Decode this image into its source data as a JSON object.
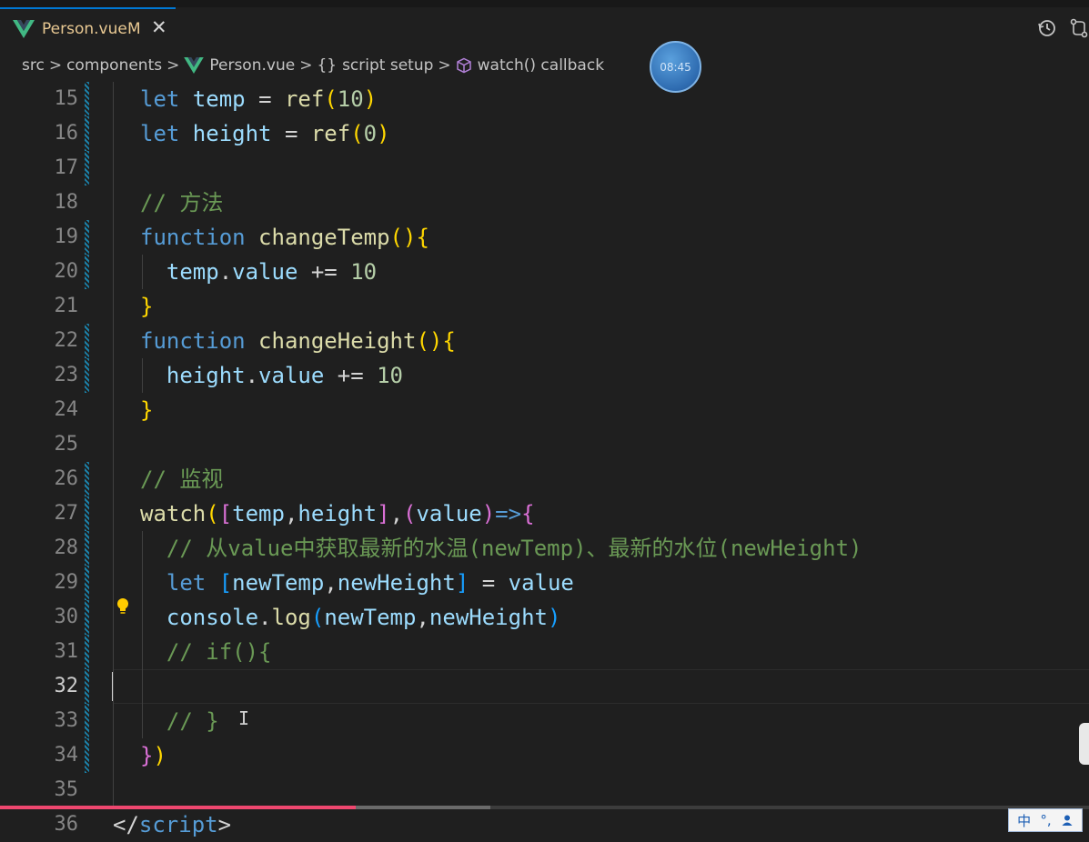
{
  "tab": {
    "filename": "Person.vue",
    "modified_flag": "M",
    "close_glyph": "✕"
  },
  "breadcrumb": {
    "items": [
      "src",
      "components",
      "Person.vue",
      "{}",
      "script setup",
      "watch() callback"
    ],
    "separator": ">"
  },
  "overlay": {
    "timer": "08:45"
  },
  "editor": {
    "active_line": "32",
    "lines": [
      {
        "n": "15",
        "tokens": [
          [
            "let",
            "k"
          ],
          [
            " temp ",
            "v"
          ],
          [
            "=",
            "o"
          ],
          [
            " ",
            "o"
          ],
          [
            "ref",
            "f"
          ],
          [
            "(",
            "b1"
          ],
          [
            "10",
            "n"
          ],
          [
            ")",
            "b1"
          ]
        ]
      },
      {
        "n": "16",
        "tokens": [
          [
            "let",
            "k"
          ],
          [
            " height ",
            "v"
          ],
          [
            "=",
            "o"
          ],
          [
            " ",
            "o"
          ],
          [
            "ref",
            "f"
          ],
          [
            "(",
            "b1"
          ],
          [
            "0",
            "n"
          ],
          [
            ")",
            "b1"
          ]
        ]
      },
      {
        "n": "17",
        "tokens": []
      },
      {
        "n": "18",
        "tokens": [
          [
            "// 方法",
            "c"
          ]
        ]
      },
      {
        "n": "19",
        "tokens": [
          [
            "function",
            "k"
          ],
          [
            " ",
            "o"
          ],
          [
            "changeTemp",
            "f"
          ],
          [
            "(){",
            "b1"
          ]
        ]
      },
      {
        "n": "20",
        "tokens": [
          [
            "  temp",
            "v"
          ],
          [
            ".",
            "o"
          ],
          [
            "value",
            "v"
          ],
          [
            " += ",
            "o"
          ],
          [
            "10",
            "n"
          ]
        ]
      },
      {
        "n": "21",
        "tokens": [
          [
            "}",
            "b1"
          ]
        ]
      },
      {
        "n": "22",
        "tokens": [
          [
            "function",
            "k"
          ],
          [
            " ",
            "o"
          ],
          [
            "changeHeight",
            "f"
          ],
          [
            "(){",
            "b1"
          ]
        ]
      },
      {
        "n": "23",
        "tokens": [
          [
            "  height",
            "v"
          ],
          [
            ".",
            "o"
          ],
          [
            "value",
            "v"
          ],
          [
            " += ",
            "o"
          ],
          [
            "10",
            "n"
          ]
        ]
      },
      {
        "n": "24",
        "tokens": [
          [
            "}",
            "b1"
          ]
        ]
      },
      {
        "n": "25",
        "tokens": []
      },
      {
        "n": "26",
        "tokens": [
          [
            "// 监视",
            "c"
          ]
        ]
      },
      {
        "n": "27",
        "tokens": [
          [
            "watch",
            "f"
          ],
          [
            "(",
            "b1"
          ],
          [
            "[",
            "b2"
          ],
          [
            "temp",
            "v"
          ],
          [
            ",",
            "o"
          ],
          [
            "height",
            "v"
          ],
          [
            "]",
            "b2"
          ],
          [
            ",",
            "o"
          ],
          [
            "(",
            "b2"
          ],
          [
            "value",
            "v"
          ],
          [
            ")",
            "b2"
          ],
          [
            "=>",
            "k"
          ],
          [
            "{",
            "b2"
          ]
        ]
      },
      {
        "n": "28",
        "tokens": [
          [
            "  // 从value中获取最新的水温(newTemp)、最新的水位(newHeight)",
            "c"
          ]
        ]
      },
      {
        "n": "29",
        "tokens": [
          [
            "  let",
            "k"
          ],
          [
            " ",
            "o"
          ],
          [
            "[",
            "b3"
          ],
          [
            "newTemp",
            "v"
          ],
          [
            ",",
            "o"
          ],
          [
            "newHeight",
            "v"
          ],
          [
            "]",
            "b3"
          ],
          [
            " = ",
            "o"
          ],
          [
            "value",
            "v"
          ]
        ]
      },
      {
        "n": "30",
        "tokens": [
          [
            "  console",
            "v"
          ],
          [
            ".",
            "o"
          ],
          [
            "log",
            "f"
          ],
          [
            "(",
            "b3"
          ],
          [
            "newTemp",
            "v"
          ],
          [
            ",",
            "o"
          ],
          [
            "newHeight",
            "v"
          ],
          [
            ")",
            "b3"
          ]
        ]
      },
      {
        "n": "31",
        "tokens": [
          [
            "  // if(){",
            "c"
          ]
        ]
      },
      {
        "n": "32",
        "tokens": []
      },
      {
        "n": "33",
        "tokens": [
          [
            "  // }",
            "c"
          ]
        ]
      },
      {
        "n": "34",
        "tokens": [
          [
            "}",
            "b2"
          ],
          [
            ")",
            "b1"
          ]
        ]
      },
      {
        "n": "35",
        "tokens": []
      },
      {
        "n": "36",
        "tokens": [
          [
            "</",
            "o"
          ],
          [
            "script",
            "k"
          ],
          [
            ">",
            "o"
          ]
        ]
      }
    ]
  },
  "colors": {
    "keyword": "#569cd6",
    "variable": "#9cdcfe",
    "function": "#dcdcaa",
    "number": "#b5cea8",
    "comment": "#6a9955",
    "bracket_level1": "#ffd700",
    "bracket_level2": "#da70d6",
    "bracket_level3": "#179fff",
    "modified_gutter": "#1b81a8",
    "progress_played": "#ef476f"
  },
  "video_progress": {
    "played": 0.327,
    "buffered": 0.45
  },
  "ime": {
    "mode": "中",
    "punct": "°,",
    "user_icon": "user-icon"
  },
  "icons": {
    "tab_file": "vue-logo-icon",
    "history": "history-icon",
    "compare": "compare-changes-icon",
    "method": "cube-icon",
    "lightbulb": "lightbulb-icon"
  }
}
